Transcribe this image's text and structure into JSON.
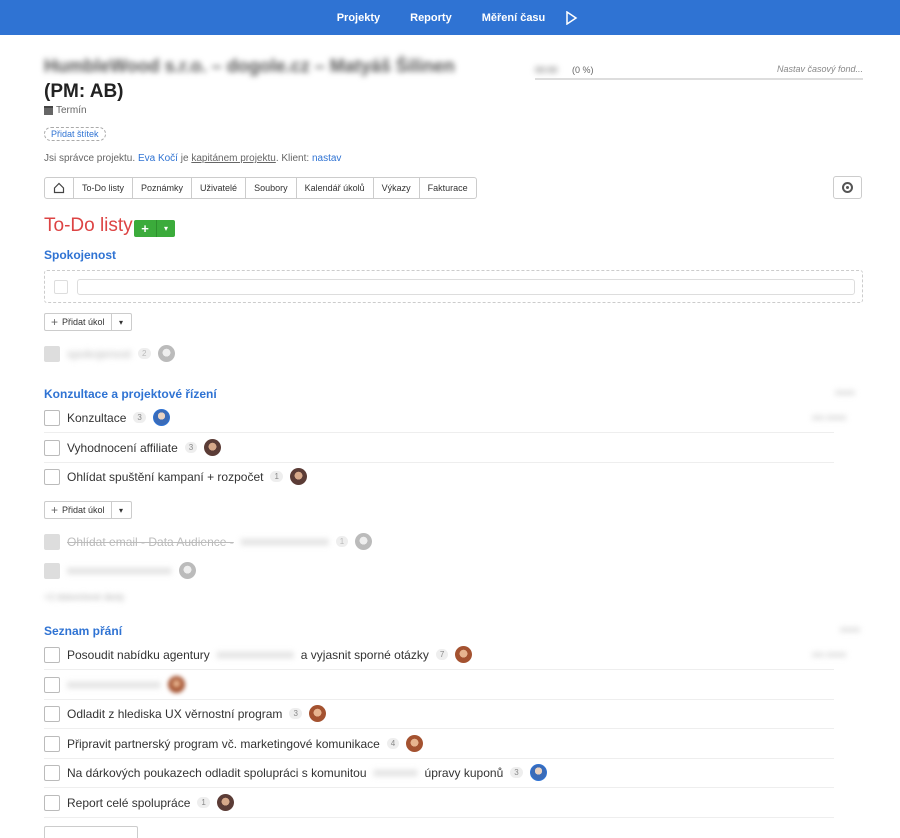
{
  "nav": {
    "projekty": "Projekty",
    "reporty": "Reporty",
    "mereni": "Měření času"
  },
  "header": {
    "title_blurred": "HumbleWood s.r.o. – dogole.cz – Matyáš Šilinen",
    "title_pm": "(PM: AB)",
    "termin": "Termín",
    "tag_button": "Přidat štítek",
    "manager_prefix": "Jsi správce projektu.",
    "manager_name": "Eva Kočí",
    "manager_mid": "je",
    "manager_role": "kapitánem projektu",
    "client_prefix": ". Klient:",
    "client_link": "nastav",
    "progress_blurred": "00:00",
    "progress_pct": "(0 %)",
    "fond": "Nastav časový fond..."
  },
  "tabs": [
    "To-Do listy",
    "Poznámky",
    "Uživatelé",
    "Soubory",
    "Kalendář úkolů",
    "Výkazy",
    "Fakturace"
  ],
  "todo": {
    "heading": "To-Do listy",
    "add_label": "+",
    "lists": [
      {
        "title": "Spokojenost"
      },
      {
        "title": "Konzultace a projektové řízení"
      },
      {
        "title": "Seznam přání"
      }
    ],
    "add_task_label": "Přidat úkol",
    "spokojenost_done": {
      "label": "spokojenost",
      "count": "2"
    },
    "konzultace_tasks": [
      {
        "label": "Konzultace",
        "count": "3",
        "avatar": "blue"
      },
      {
        "label": "Vyhodnocení affiliate",
        "count": "3",
        "avatar": "dark"
      },
      {
        "label": "Ohlídat spuštění kampaní + rozpočet",
        "count": "1",
        "avatar": "dark"
      }
    ],
    "konzultace_done": [
      {
        "label": "Ohlídat email - Data Audience -",
        "count": "1"
      },
      {
        "label": "",
        "count": ""
      }
    ],
    "konzultace_more": "+2 dokončené úkoly",
    "prani_tasks": [
      {
        "label": "Posoudit nabídku agentury",
        "label_tail": "a vyjasnit sporné otázky",
        "count": "7",
        "avatar": "brown"
      },
      {
        "label": "",
        "count": "",
        "avatar": "brown"
      },
      {
        "label": "Odladit z hlediska UX věrnostní program",
        "count": "3",
        "avatar": "brown"
      },
      {
        "label": "Připravit partnerský program vč. marketingové komunikace",
        "count": "4",
        "avatar": "brown"
      },
      {
        "label": "Na dárkových poukazech odladit spolupráci s komunitou",
        "label_tail": "úpravy kuponů",
        "count": "3",
        "avatar": "blue"
      },
      {
        "label": "Report celé spolupráce",
        "count": "1",
        "avatar": "dark"
      }
    ]
  },
  "colors": {
    "topbar": "#2f73d3",
    "heading_red": "#dd4444",
    "link_blue": "#2f73d3",
    "green": "#3bab3b"
  }
}
